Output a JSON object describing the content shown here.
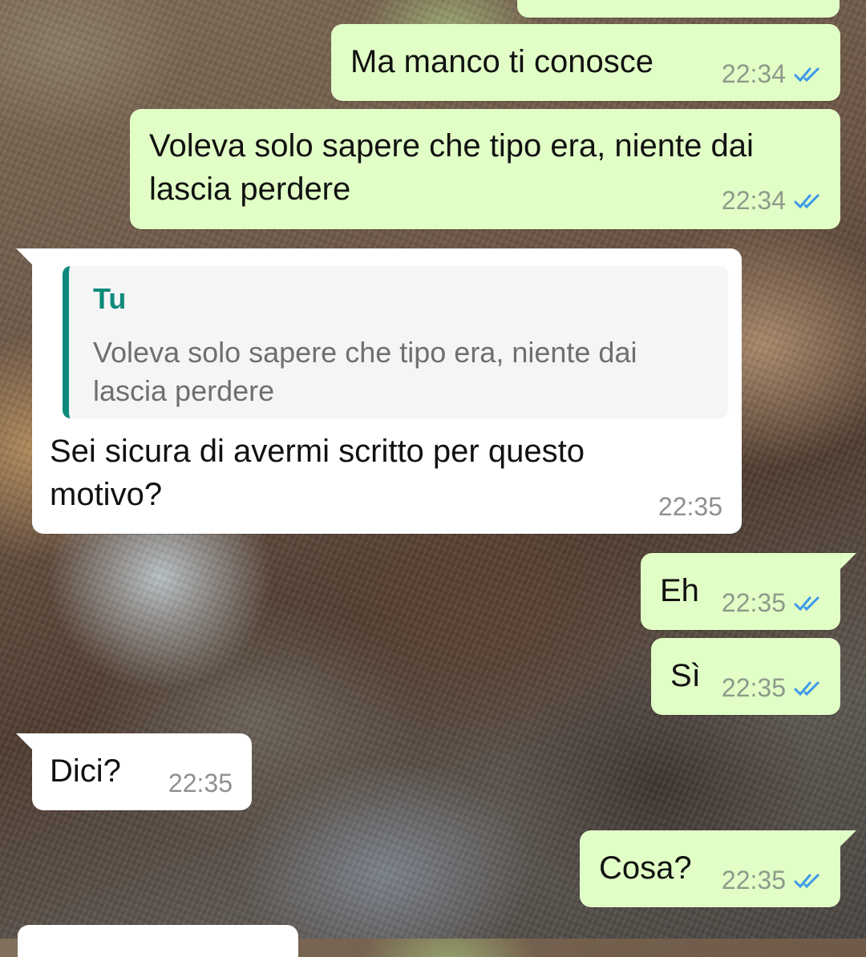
{
  "messages": [
    {
      "text": "",
      "time": ""
    },
    {
      "text": "Ma manco ti conosce",
      "time": "22:34",
      "direction": "out",
      "status": "read"
    },
    {
      "text": "Voleva solo sapere che tipo era, niente dai lascia perdere",
      "time": "22:34",
      "direction": "out",
      "status": "read"
    },
    {
      "text": "Sei sicura di avermi scritto per questo motivo?",
      "time": "22:35",
      "direction": "in",
      "reply": {
        "author": "Tu",
        "text": "Voleva solo sapere che tipo era, niente dai lascia perdere"
      }
    },
    {
      "text": "Eh",
      "time": "22:35",
      "direction": "out",
      "status": "read"
    },
    {
      "text": "Sì",
      "time": "22:35",
      "direction": "out",
      "status": "read"
    },
    {
      "text": "Dici?",
      "time": "22:35",
      "direction": "in"
    },
    {
      "text": "Cosa?",
      "time": "22:35",
      "direction": "out",
      "status": "read"
    }
  ],
  "colors": {
    "outgoing_bubble": "#e1fec6",
    "incoming_bubble": "#ffffff",
    "read_ticks": "#3b9ae8",
    "quote_accent": "#0e8a7c"
  },
  "icons": {
    "read_status": "double-check-icon"
  }
}
